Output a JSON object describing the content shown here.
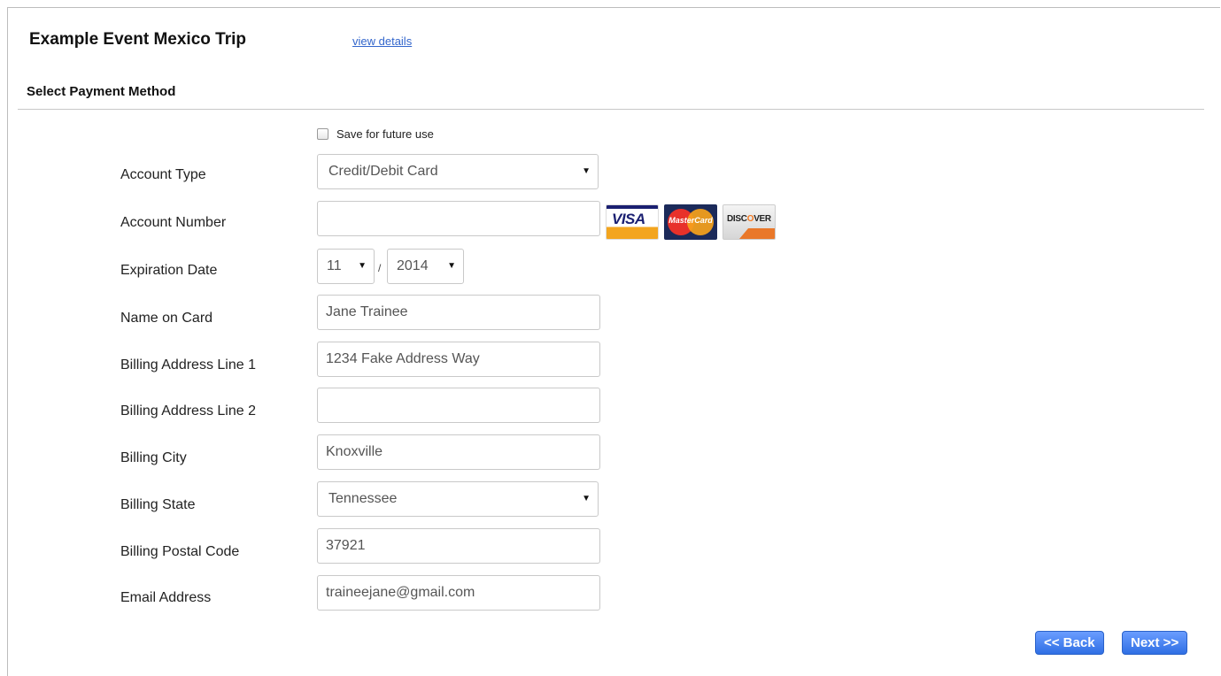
{
  "header": {
    "event_title": "Example Event Mexico Trip",
    "view_details": "view details"
  },
  "section": {
    "title": "Select Payment Method"
  },
  "save_option": {
    "label": "Save for future use",
    "checked": false
  },
  "form": {
    "account_type": {
      "label": "Account Type",
      "value": "Credit/Debit Card"
    },
    "account_number": {
      "label": "Account Number",
      "value": ""
    },
    "expiration": {
      "label": "Expiration Date",
      "month": "11",
      "year": "2014",
      "separator": "/"
    },
    "name_on_card": {
      "label": "Name on Card",
      "value": "Jane Trainee"
    },
    "address1": {
      "label": "Billing Address Line 1",
      "value": "1234 Fake Address Way"
    },
    "address2": {
      "label": "Billing Address Line 2",
      "value": ""
    },
    "city": {
      "label": "Billing City",
      "value": "Knoxville"
    },
    "state": {
      "label": "Billing State",
      "value": "Tennessee"
    },
    "postal": {
      "label": "Billing Postal Code",
      "value": "37921"
    },
    "email": {
      "label": "Email Address",
      "value": "traineejane@gmail.com"
    }
  },
  "cards": {
    "visa": "VISA",
    "mastercard": "MasterCard",
    "discover_pre": "DISC",
    "discover_o": "O",
    "discover_post": "VER"
  },
  "buttons": {
    "back": "<< Back",
    "next": "Next >>"
  },
  "icons": {
    "caret": "▼"
  }
}
